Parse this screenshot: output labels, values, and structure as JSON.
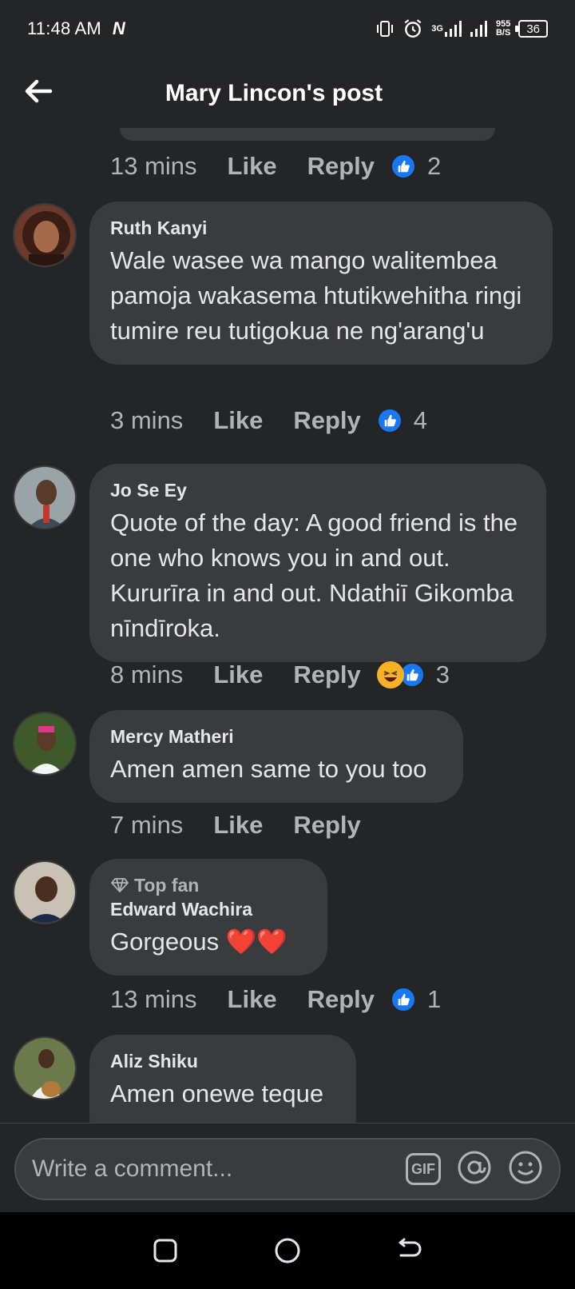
{
  "status_bar": {
    "time": "11:48 AM",
    "carrier_icon": "N",
    "network_type": "3G",
    "net_speed_value": "955",
    "net_speed_unit": "B/S",
    "battery": "36"
  },
  "header": {
    "title": "Mary Lincon's post",
    "back_icon": "arrow-left-icon"
  },
  "labels": {
    "like": "Like",
    "reply": "Reply"
  },
  "first_meta": {
    "time": "13 mins",
    "reaction_count": "2"
  },
  "comments": [
    {
      "name": "Ruth Kanyi",
      "text": "Wale wasee wa mango walitembea pamoja wakasema htutikwehitha ringi tumire reu tutigokua ne ng'arang'u",
      "time": "3 mins",
      "reactions": [
        "like"
      ],
      "reaction_count": "4"
    },
    {
      "name": "Jo Se Ey",
      "text": "Quote of the day: A good friend is the one who knows you in and out. Kururīra in and out. Ndathiī Gikomba nīndīroka.",
      "time": "8 mins",
      "reactions": [
        "haha",
        "like"
      ],
      "reaction_count": "3"
    },
    {
      "name": "Mercy Matheri",
      "text": "Amen amen same to you too",
      "time": "7 mins",
      "reactions": [],
      "reaction_count": ""
    },
    {
      "badge": "Top fan",
      "name": "Edward Wachira",
      "text": "Gorgeous ❤️❤️",
      "time": "13 mins",
      "reactions": [
        "like"
      ],
      "reaction_count": "1"
    },
    {
      "name": "Aliz Shiku",
      "text": "Amen onewe teque",
      "time": "",
      "reactions": [],
      "reaction_count": ""
    }
  ],
  "composer": {
    "placeholder": "Write a comment...",
    "gif_label": "GIF"
  },
  "colors": {
    "background": "#242526",
    "bubble": "#3a3b3c",
    "like_blue": "#1877f2",
    "text_secondary": "#b0b3b8"
  }
}
